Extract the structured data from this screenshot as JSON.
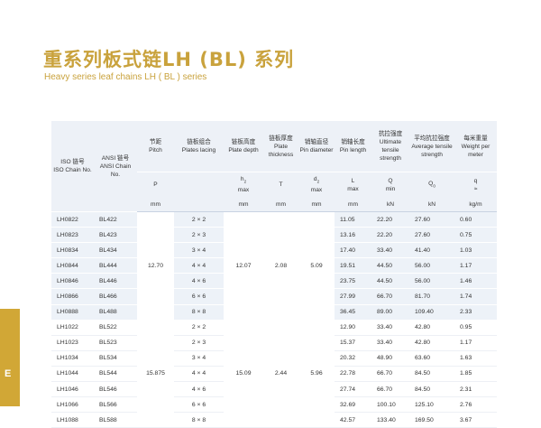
{
  "title_cn": "重系列板式链LH (BL) 系列",
  "title_en": "Heavy series leaf chains LH ( BL ) series",
  "side_tab_letter": "E",
  "headers": [
    {
      "cn": "ISO 链号",
      "en": "ISO Chain No.",
      "symbol": "",
      "unit": ""
    },
    {
      "cn": "ANSI 链号",
      "en": "ANSI Chain No.",
      "symbol": "",
      "unit": ""
    },
    {
      "cn": "节距",
      "en": "Pitch",
      "symbol": "P",
      "unit": "mm"
    },
    {
      "cn": "链板组合",
      "en": "Plates lacing",
      "symbol": "",
      "unit": ""
    },
    {
      "cn": "链板高度",
      "en": "Plate depth",
      "symbol": "h2 max",
      "unit": "mm"
    },
    {
      "cn": "链板厚度",
      "en": "Plate thickness",
      "symbol": "T",
      "unit": "mm"
    },
    {
      "cn": "销轴直径",
      "en": "Pin diameter",
      "symbol": "d2 max",
      "unit": "mm"
    },
    {
      "cn": "销轴长度",
      "en": "Pin length",
      "symbol": "L max",
      "unit": "mm"
    },
    {
      "cn": "抗拉强度",
      "en": "Ultimate tensile strength",
      "symbol": "Q min",
      "unit": "kN"
    },
    {
      "cn": "平均抗拉强度",
      "en": "Average tensile strength",
      "symbol": "Q0",
      "unit": "kN"
    },
    {
      "cn": "每米重量",
      "en": "Weight per meter",
      "symbol": "q ≈",
      "unit": "kg/m"
    }
  ],
  "groups": [
    {
      "pitch": "12.70",
      "plate_depth": "12.07",
      "plate_thickness": "2.08",
      "pin_diameter": "5.09",
      "rows": [
        {
          "iso": "LH0822",
          "ansi": "BL422",
          "lacing": "2 × 2",
          "pin_length": "11.05",
          "q_min": "22.20",
          "q_avg": "27.60",
          "weight": "0.60"
        },
        {
          "iso": "LH0823",
          "ansi": "BL423",
          "lacing": "2 × 3",
          "pin_length": "13.16",
          "q_min": "22.20",
          "q_avg": "27.60",
          "weight": "0.75"
        },
        {
          "iso": "LH0834",
          "ansi": "BL434",
          "lacing": "3 × 4",
          "pin_length": "17.40",
          "q_min": "33.40",
          "q_avg": "41.40",
          "weight": "1.03"
        },
        {
          "iso": "LH0844",
          "ansi": "BL444",
          "lacing": "4 × 4",
          "pin_length": "19.51",
          "q_min": "44.50",
          "q_avg": "56.00",
          "weight": "1.17"
        },
        {
          "iso": "LH0846",
          "ansi": "BL446",
          "lacing": "4 × 6",
          "pin_length": "23.75",
          "q_min": "44.50",
          "q_avg": "56.00",
          "weight": "1.46"
        },
        {
          "iso": "LH0866",
          "ansi": "BL466",
          "lacing": "6 × 6",
          "pin_length": "27.99",
          "q_min": "66.70",
          "q_avg": "81.70",
          "weight": "1.74"
        },
        {
          "iso": "LH0888",
          "ansi": "BL488",
          "lacing": "8 × 8",
          "pin_length": "36.45",
          "q_min": "89.00",
          "q_avg": "109.40",
          "weight": "2.33"
        }
      ]
    },
    {
      "pitch": "15.875",
      "plate_depth": "15.09",
      "plate_thickness": "2.44",
      "pin_diameter": "5.96",
      "rows": [
        {
          "iso": "LH1022",
          "ansi": "BL522",
          "lacing": "2 × 2",
          "pin_length": "12.90",
          "q_min": "33.40",
          "q_avg": "42.80",
          "weight": "0.95"
        },
        {
          "iso": "LH1023",
          "ansi": "BL523",
          "lacing": "2 × 3",
          "pin_length": "15.37",
          "q_min": "33.40",
          "q_avg": "42.80",
          "weight": "1.17"
        },
        {
          "iso": "LH1034",
          "ansi": "BL534",
          "lacing": "3 × 4",
          "pin_length": "20.32",
          "q_min": "48.90",
          "q_avg": "63.60",
          "weight": "1.63"
        },
        {
          "iso": "LH1044",
          "ansi": "BL544",
          "lacing": "4 × 4",
          "pin_length": "22.78",
          "q_min": "66.70",
          "q_avg": "84.50",
          "weight": "1.85"
        },
        {
          "iso": "LH1046",
          "ansi": "BL546",
          "lacing": "4 × 6",
          "pin_length": "27.74",
          "q_min": "66.70",
          "q_avg": "84.50",
          "weight": "2.31"
        },
        {
          "iso": "LH1066",
          "ansi": "BL566",
          "lacing": "6 × 6",
          "pin_length": "32.69",
          "q_min": "100.10",
          "q_avg": "125.10",
          "weight": "2.76"
        },
        {
          "iso": "LH1088",
          "ansi": "BL588",
          "lacing": "8 × 8",
          "pin_length": "42.57",
          "q_min": "133.40",
          "q_avg": "169.50",
          "weight": "3.67"
        }
      ]
    }
  ]
}
